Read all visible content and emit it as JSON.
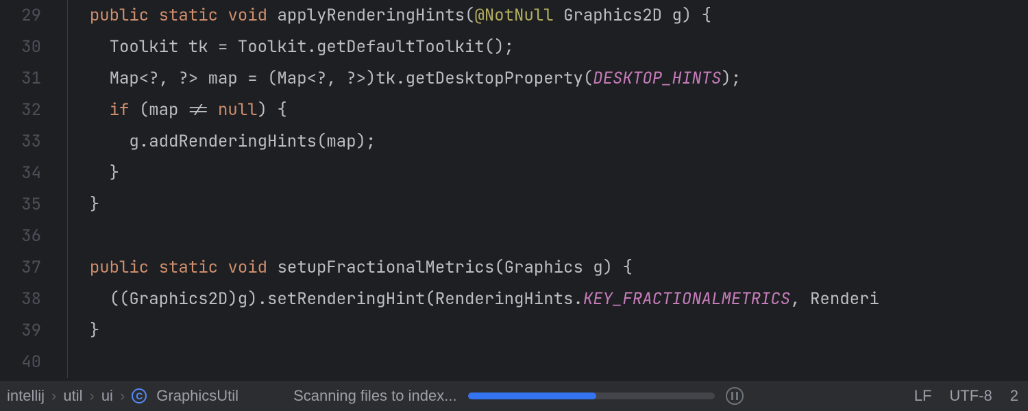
{
  "lines": [
    {
      "num": "29",
      "indent": 1,
      "tokens": [
        {
          "t": "public ",
          "c": "kw"
        },
        {
          "t": "static ",
          "c": "kw"
        },
        {
          "t": "void ",
          "c": "kw"
        },
        {
          "t": "applyRenderingHints",
          "c": "method"
        },
        {
          "t": "(",
          "c": "punct"
        },
        {
          "t": "@NotNull ",
          "c": "annot"
        },
        {
          "t": "Graphics2D g",
          "c": "ident"
        },
        {
          "t": ") {",
          "c": "punct"
        }
      ]
    },
    {
      "num": "30",
      "indent": 2,
      "tokens": [
        {
          "t": "Toolkit tk = Toolkit.getDefaultToolkit();",
          "c": "ident"
        }
      ]
    },
    {
      "num": "31",
      "indent": 2,
      "tokens": [
        {
          "t": "Map<?, ?> map = (Map<?, ?>)tk.getDesktopProperty(",
          "c": "ident"
        },
        {
          "t": "DESKTOP_HINTS",
          "c": "field"
        },
        {
          "t": ");",
          "c": "punct"
        }
      ]
    },
    {
      "num": "32",
      "indent": 2,
      "tokens": [
        {
          "t": "if ",
          "c": "kw"
        },
        {
          "t": "(map != ",
          "c": "ident"
        },
        {
          "t": "null",
          "c": "kw"
        },
        {
          "t": ") {",
          "c": "punct"
        }
      ]
    },
    {
      "num": "33",
      "indent": 3,
      "tokens": [
        {
          "t": "g.addRenderingHints(map);",
          "c": "ident"
        }
      ]
    },
    {
      "num": "34",
      "indent": 2,
      "tokens": [
        {
          "t": "}",
          "c": "punct"
        }
      ]
    },
    {
      "num": "35",
      "indent": 1,
      "tokens": [
        {
          "t": "}",
          "c": "punct"
        }
      ]
    },
    {
      "num": "36",
      "indent": 0,
      "tokens": []
    },
    {
      "num": "37",
      "indent": 1,
      "tokens": [
        {
          "t": "public ",
          "c": "kw"
        },
        {
          "t": "static ",
          "c": "kw"
        },
        {
          "t": "void ",
          "c": "kw"
        },
        {
          "t": "setupFractionalMetrics",
          "c": "method"
        },
        {
          "t": "(Graphics g) {",
          "c": "ident"
        }
      ]
    },
    {
      "num": "38",
      "indent": 2,
      "tokens": [
        {
          "t": "((Graphics2D)g).setRenderingHint(RenderingHints.",
          "c": "ident"
        },
        {
          "t": "KEY_FRACTIONALMETRICS",
          "c": "field"
        },
        {
          "t": ", Renderi",
          "c": "ident"
        }
      ]
    },
    {
      "num": "39",
      "indent": 1,
      "tokens": [
        {
          "t": "}",
          "c": "punct"
        }
      ]
    },
    {
      "num": "40",
      "indent": 0,
      "tokens": []
    }
  ],
  "breadcrumbs": {
    "items": [
      "intellij",
      "util",
      "ui",
      "GraphicsUtil"
    ],
    "class_letter": "C"
  },
  "status": {
    "scanning": "Scanning files to index...",
    "progress_percent": 52,
    "line_sep": "LF",
    "encoding": "UTF-8",
    "right_num": "2"
  }
}
